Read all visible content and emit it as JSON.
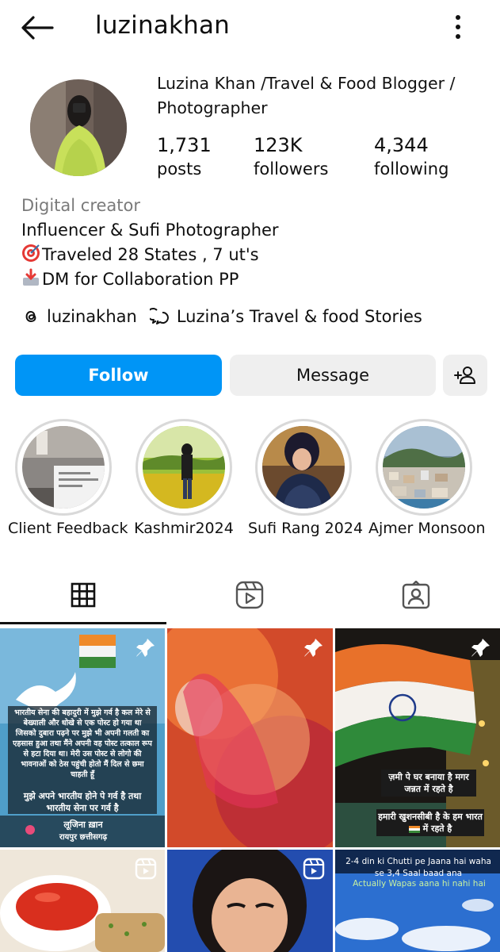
{
  "header": {
    "username": "luzinakhan",
    "back_icon": "arrow-left-icon",
    "menu_icon": "more-vertical-icon"
  },
  "profile": {
    "full_name": "Luzina Khan /Travel & Food Blogger / Photographer",
    "stats": [
      {
        "value": "1,731",
        "label": "posts"
      },
      {
        "value": "123K",
        "label": "followers"
      },
      {
        "value": "4,344",
        "label": "following"
      }
    ],
    "category": "Digital creator",
    "bio_lines": [
      "Influencer & Sufi Photographer",
      "Traveled 28 States , 7 ut's",
      "DM for Collaboration PP"
    ],
    "threads_handle": "luzinakhan",
    "channel_name": "Luzina’s Travel & food Stories"
  },
  "actions": {
    "follow_label": "Follow",
    "message_label": "Message",
    "add_user_icon": "add-user-icon"
  },
  "highlights": [
    {
      "label": "Client Feedback"
    },
    {
      "label": "Kashmir2024"
    },
    {
      "label": "Sufi Rang 2024"
    },
    {
      "label": "Ajmer Monsoon"
    }
  ],
  "tabs": [
    "grid-icon",
    "reels-icon",
    "tagged-icon"
  ],
  "grid": {
    "tile1_text": "भारतीय सेना की बहादुरी में मुझे गर्व है कल मेरे से बेख्याली और धोखे से एक पोस्ट हो गया था जिसको दुबारा पढ़ने पर मुझे भी अपनी गलती का एहसास हुआ तथा मैंने अपनी वह पोस्ट तत्काल रूप से हटा दिया था। मेरी उस पोस्ट से लोगो की भावनाओं को ठेस पहुंची होतो मैं दिल से छमा चाहती हूँ",
    "tile1_text2": "मुझे अपने भारतीय होने पे गर्व है तथा भारतीय सेना पर गर्व है",
    "tile1_sign": "लूजिना ख़ान",
    "tile1_place": "रायपुर छत्तीसगढ़",
    "tile3_text1": "ज़मी पे  घर बनाया है मगर जन्नत में रहते है",
    "tile3_text2": "हमारी खुशनसीबी है के हम भारत",
    "tile3_text2b": "में रहते है",
    "tile6_text1": "2-4 din ki Chutti pe Jaana hai waha se 3,4 Saal baad ana",
    "tile6_text2": "Actually Wapas aana hi nahi hai"
  },
  "colors": {
    "follow_blue": "#0095f6",
    "secondary_button": "#efefef",
    "category_gray": "#7a7a7a"
  }
}
